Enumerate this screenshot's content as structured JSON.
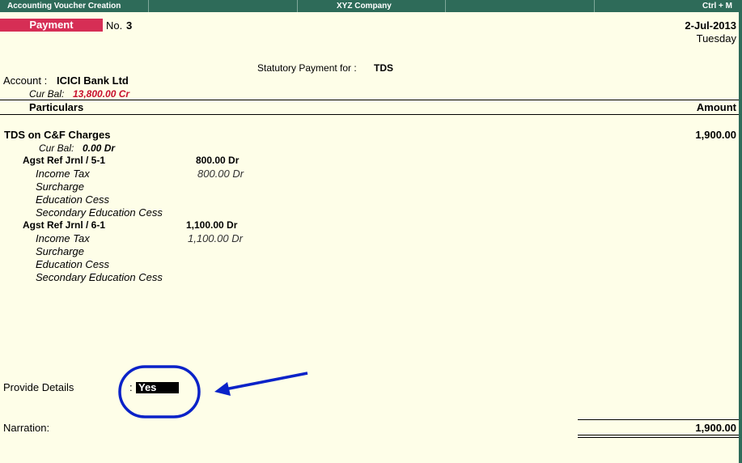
{
  "titlebar": {
    "left": "Accounting Voucher  Creation",
    "center": "XYZ Company",
    "right": "Ctrl + M"
  },
  "voucher": {
    "type": "Payment",
    "no_label": "No.",
    "no_value": "3",
    "date": "2-Jul-2013",
    "day": "Tuesday",
    "statutory_label": "Statutory Payment for :",
    "statutory_value": "TDS"
  },
  "account": {
    "label": "Account :",
    "name": "ICICI Bank Ltd",
    "cur_bal_label": "Cur Bal:",
    "cur_bal_value": "13,800.00 Cr"
  },
  "table": {
    "col_particulars": "Particulars",
    "col_amount": "Amount"
  },
  "ledger": {
    "name": "TDS on C&F Charges",
    "amount": "1,900.00",
    "cur_bal_label": "Cur Bal:",
    "cur_bal_value": "0.00 Dr",
    "refs": [
      {
        "label": "Agst Ref  Jrnl / 5-1",
        "amount": "800.00 Dr",
        "details": [
          {
            "name": "Income Tax",
            "amount": "800.00 Dr"
          },
          {
            "name": "Surcharge",
            "amount": ""
          },
          {
            "name": "Education Cess",
            "amount": ""
          },
          {
            "name": "Secondary Education Cess",
            "amount": ""
          }
        ]
      },
      {
        "label": "Agst Ref  Jrnl / 6-1",
        "amount": "1,100.00 Dr",
        "details": [
          {
            "name": "Income Tax",
            "amount": "1,100.00 Dr"
          },
          {
            "name": "Surcharge",
            "amount": ""
          },
          {
            "name": "Education Cess",
            "amount": ""
          },
          {
            "name": "Secondary Education Cess",
            "amount": ""
          }
        ]
      }
    ]
  },
  "provide_details": {
    "label": "Provide Details",
    "colon": ":",
    "value": "Yes"
  },
  "narration": {
    "label": "Narration:",
    "total": "1,900.00"
  },
  "colors": {
    "titlebar": "#2e6b59",
    "voucher_type": "#d62e55",
    "annotation": "#0a22c8",
    "background": "#fefee8"
  }
}
